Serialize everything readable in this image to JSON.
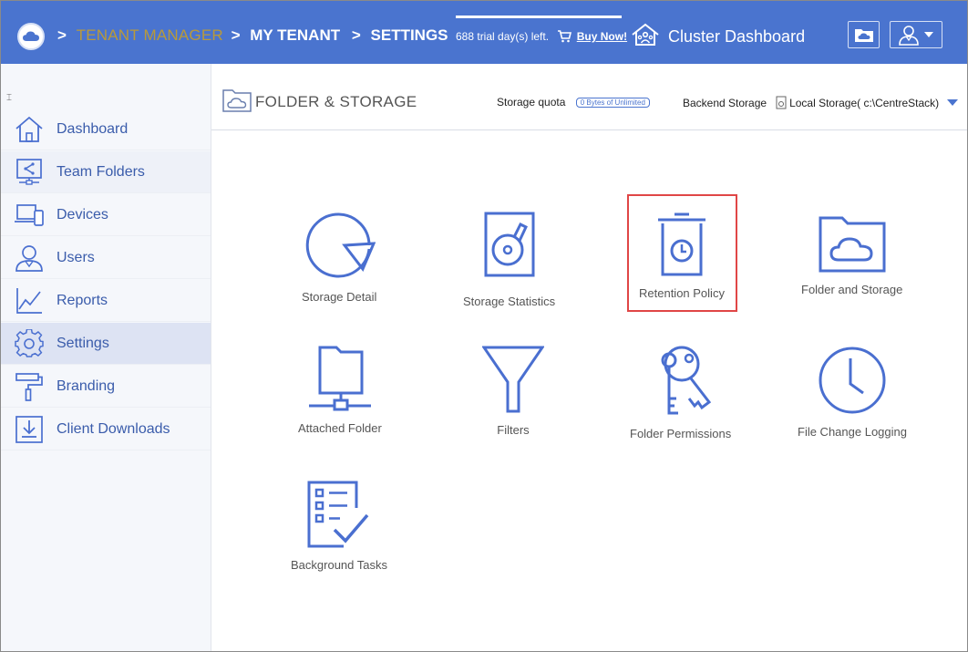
{
  "header": {
    "breadcrumb": [
      {
        "sep": ">",
        "label": "TENANT MANAGER"
      },
      {
        "sep": ">",
        "label": "MY TENANT"
      },
      {
        "sep": ">",
        "label": "SETTINGS"
      }
    ],
    "trial_text": "688 trial day(s) left.",
    "buy_label": "Buy Now!",
    "cluster_label": "Cluster Dashboard",
    "colors": {
      "bar": "#4a74cf",
      "tenant_manager": "#b99a3a"
    }
  },
  "sidebar": {
    "collapse_glyph": "⌶",
    "items": [
      {
        "label": "Dashboard",
        "icon": "home-icon"
      },
      {
        "label": "Team Folders",
        "icon": "team-folders-icon"
      },
      {
        "label": "Devices",
        "icon": "devices-icon"
      },
      {
        "label": "Users",
        "icon": "user-icon"
      },
      {
        "label": "Reports",
        "icon": "chart-icon"
      },
      {
        "label": "Settings",
        "icon": "gear-icon"
      },
      {
        "label": "Branding",
        "icon": "paint-roller-icon"
      },
      {
        "label": "Client Downloads",
        "icon": "download-icon"
      }
    ],
    "active": "Settings"
  },
  "main": {
    "title": "FOLDER & STORAGE",
    "storage_quota_label": "Storage quota",
    "storage_quota_value": "0 Bytes of Unlimited",
    "backend_label": "Backend Storage",
    "backend_value": "Local Storage( c:\\CentreStack)",
    "tiles": [
      {
        "label": "Storage Detail",
        "icon": "pie-chart-icon"
      },
      {
        "label": "Storage Statistics",
        "icon": "hard-disk-icon"
      },
      {
        "label": "Retention Policy",
        "icon": "trash-clock-icon",
        "highlighted": true
      },
      {
        "label": "Folder and Storage",
        "icon": "cloud-folder-icon"
      },
      {
        "label": "Attached Folder",
        "icon": "network-folder-icon"
      },
      {
        "label": "Filters",
        "icon": "funnel-icon"
      },
      {
        "label": "Folder Permissions",
        "icon": "keys-icon"
      },
      {
        "label": "File Change Logging",
        "icon": "clock-icon"
      },
      {
        "label": "Background Tasks",
        "icon": "checklist-icon"
      }
    ],
    "icon_color": "#4a6fd0",
    "highlight_color": "#e04646"
  }
}
